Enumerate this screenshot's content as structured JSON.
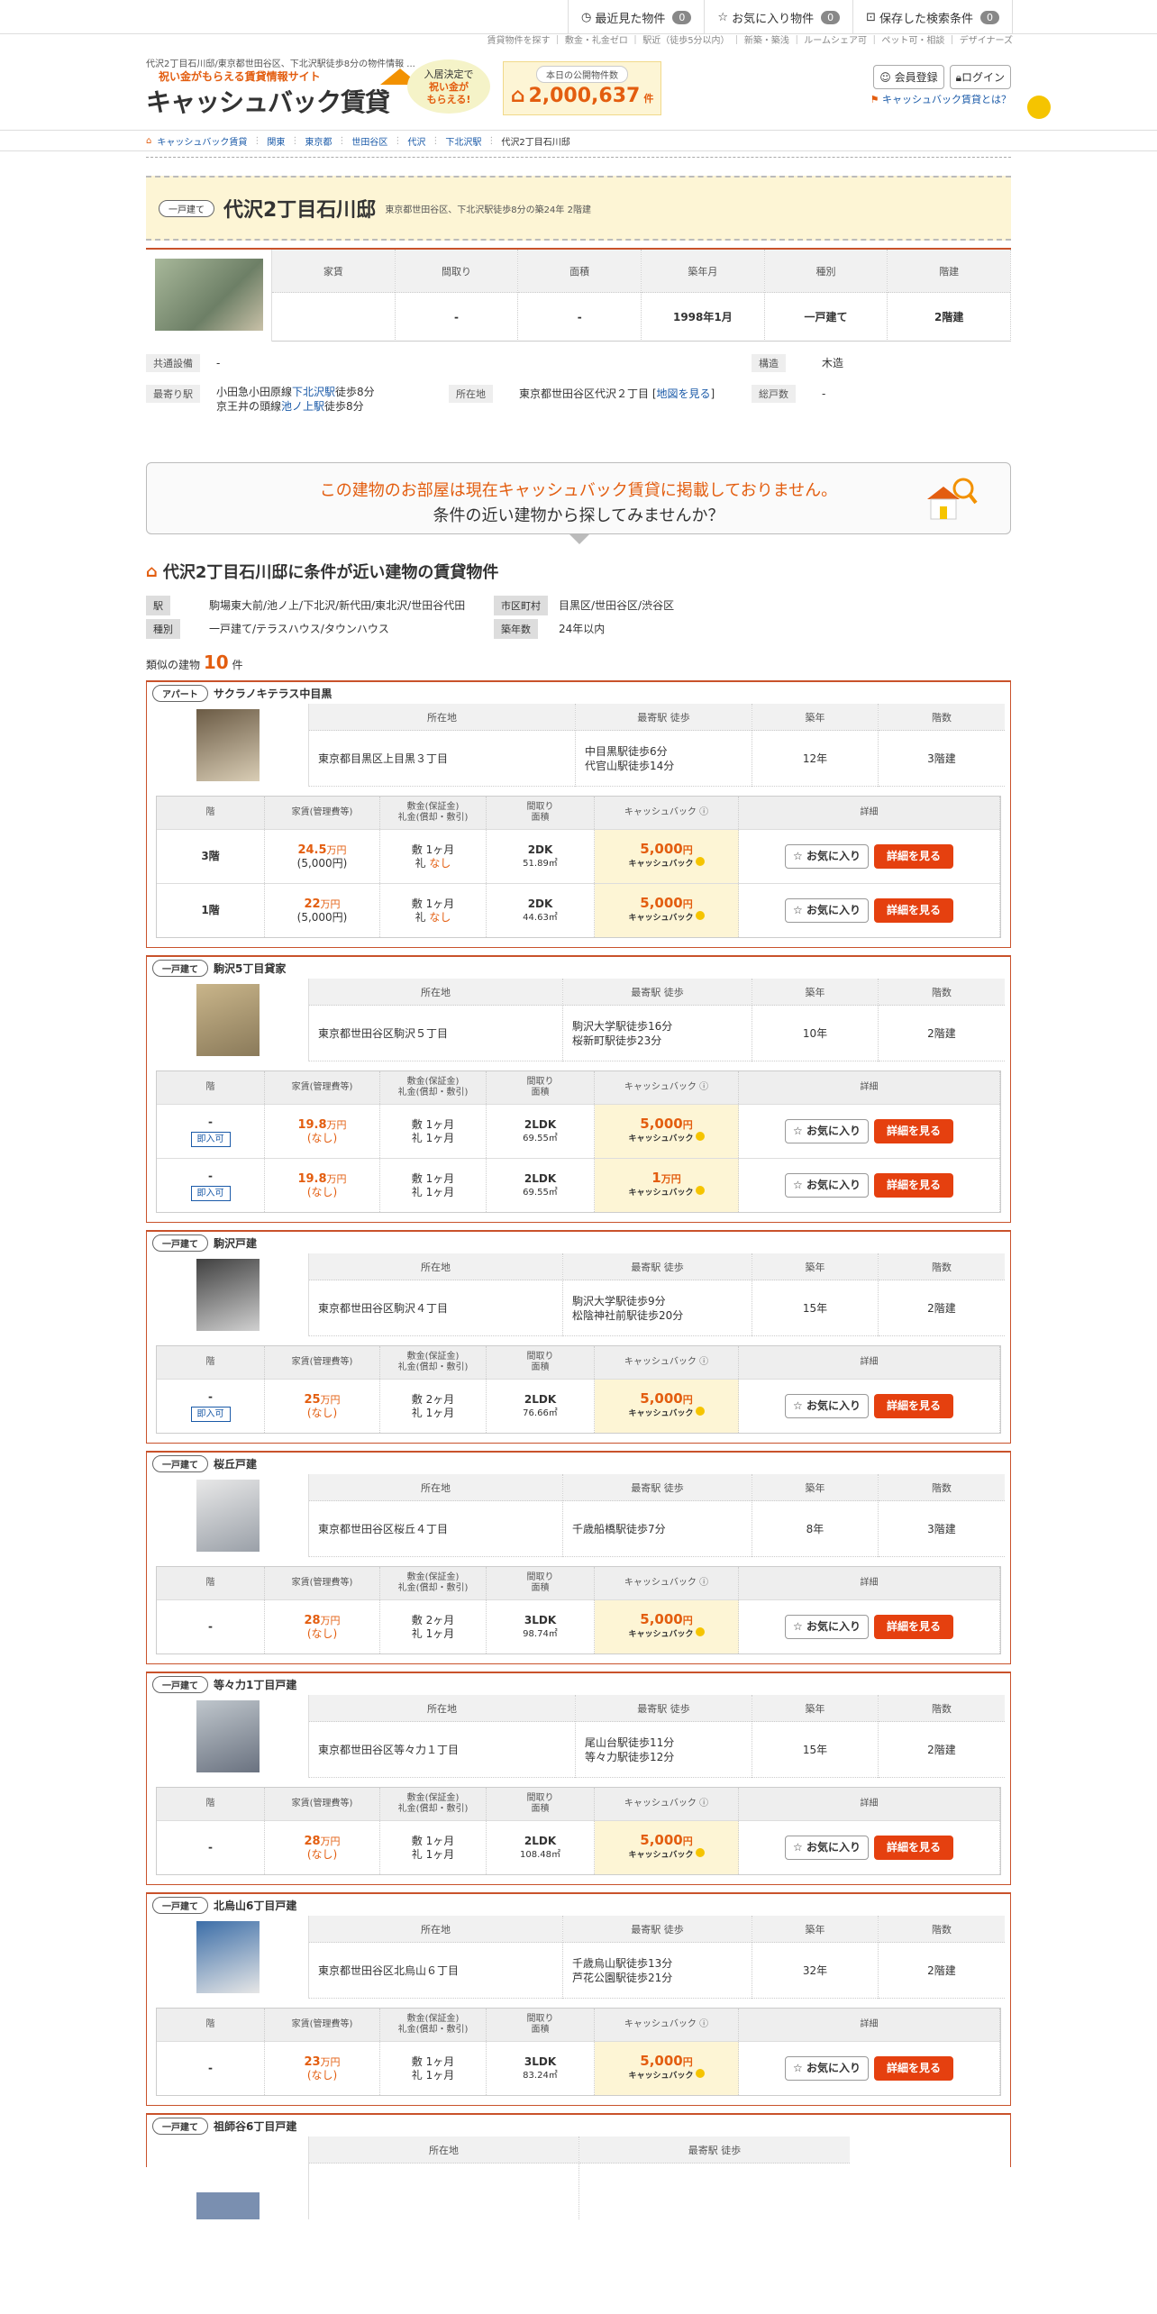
{
  "topnav": {
    "recent": "最近見た物件",
    "recent_count": "0",
    "fav": "お気に入り物件",
    "fav_count": "0",
    "saved": "保存した検索条件",
    "saved_count": "0"
  },
  "subnav": "賃貸物件を探す ｜ 敷金・礼金ゼロ ｜ 駅近（徒歩5分以内） ｜ 新築・築浅 ｜ ルームシェア可 ｜ ペット可・相談 ｜ デザイナーズ",
  "header": {
    "desc": "代沢2丁目石川邸/東京都世田谷区、下北沢駅徒歩8分の物件情報 ...",
    "logo_sub": "祝い金がもらえる賃貸情報サイト",
    "logo_main": "キャッシュバック賃貸",
    "bubble1": "入居決定で",
    "bubble2": "祝い金が",
    "bubble3": "もらえる!",
    "pub_label": "本日の公開物件数",
    "pub_num": "2,000,637",
    "pub_unit": "件",
    "register": "会員登録",
    "login": "ログイン",
    "whatis": "キャッシュバック賃貸とは？"
  },
  "breadcrumb": [
    "キャッシュバック賃貸",
    "関東",
    "東京都",
    "世田谷区",
    "代沢",
    "下北沢駅",
    "代沢2丁目石川邸"
  ],
  "building": {
    "tag": "一戸建て",
    "name": "代沢2丁目石川邸",
    "sub": "東京都世田谷区、下北沢駅徒歩8分の築24年 2階建",
    "cols": [
      {
        "h": "家賃",
        "v": ""
      },
      {
        "h": "間取り",
        "v": "-"
      },
      {
        "h": "面積",
        "v": "-"
      },
      {
        "h": "築年月",
        "v": "1998年1月"
      },
      {
        "h": "種別",
        "v": "一戸建て"
      },
      {
        "h": "階建",
        "v": "2階建"
      }
    ],
    "facility_label": "共通設備",
    "facility": "-",
    "structure_label": "構造",
    "structure": "木造",
    "station_label": "最寄り駅",
    "station1a": "小田急小田原線",
    "station1b": "下北沢駅",
    "station1c": "徒歩8分",
    "station2a": "京王井の頭線",
    "station2b": "池ノ上駅",
    "station2c": "徒歩8分",
    "address_label": "所在地",
    "address": "東京都世田谷区代沢２丁目",
    "map": "地図を見る",
    "units_label": "総戸数",
    "units": "-"
  },
  "notice": {
    "l1": "この建物のお部屋は現在キャッシュバック賃貸に掲載しておりません。",
    "l2": "条件の近い建物から探してみませんか？"
  },
  "section": {
    "title": "代沢2丁目石川邸に条件が近い建物の賃貸物件",
    "st_label": "駅",
    "st": "駒場東大前/池ノ上/下北沢/新代田/東北沢/世田谷代田",
    "city_label": "市区町村",
    "city": "目黒区/世田谷区/渋谷区",
    "type_label": "種別",
    "type": "一戸建て/テラスハウス/タウンハウス",
    "age_label": "築年数",
    "age": "24年以内",
    "similar_pre": "類似の建物",
    "similar_num": "10",
    "similar_unit": "件"
  },
  "headers": {
    "addr": "所在地",
    "station": "最寄駅 徒歩",
    "age": "築年",
    "floors": "階数",
    "floor": "階",
    "rent1": "家賃(管理費等)",
    "dep1": "敷金(保証金)",
    "dep2": "礼金(償却・敷引)",
    "lay1": "間取り",
    "lay2": "面積",
    "cb": "キャッシュバック",
    "detail": "詳細",
    "fav": "お気に入り",
    "view": "詳細を見る",
    "cb_sub": "キャッシュバック",
    "soku": "即入可"
  },
  "cards": [
    {
      "tag": "アパート",
      "name": "サクラノキテラス中目黒",
      "addr": "東京都目黒区上目黒３丁目",
      "st1": "中目黒駅徒歩6分",
      "st2": "代官山駅徒歩14分",
      "age": "12年",
      "floors": "3階建",
      "rows": [
        {
          "floor": "3階",
          "rent": "24.5",
          "mgmt": "(5,000円)",
          "shiki": "敷 1ヶ月",
          "rei_pre": "礼",
          "rei": "なし",
          "lay": "2DK",
          "area": "51.89㎡",
          "cb": "5,000",
          "cbu": "円"
        },
        {
          "floor": "1階",
          "rent": "22",
          "mgmt": "(5,000円)",
          "shiki": "敷 1ヶ月",
          "rei_pre": "礼",
          "rei": "なし",
          "lay": "2DK",
          "area": "44.63㎡",
          "cb": "5,000",
          "cbu": "円"
        }
      ]
    },
    {
      "tag": "一戸建て",
      "name": "駒沢5丁目貸家",
      "addr": "東京都世田谷区駒沢５丁目",
      "st1": "駒沢大学駅徒歩16分",
      "st2": "桜新町駅徒歩23分",
      "age": "10年",
      "floors": "2階建",
      "rows": [
        {
          "floor": "-",
          "rent": "19.8",
          "mgmt": "(なし)",
          "shiki": "敷 1ヶ月",
          "rei_pre": "礼",
          "rei": "1ヶ月",
          "lay": "2LDK",
          "area": "69.55㎡",
          "cb": "5,000",
          "cbu": "円"
        },
        {
          "floor": "-",
          "rent": "19.8",
          "mgmt": "(なし)",
          "shiki": "敷 1ヶ月",
          "rei_pre": "礼",
          "rei": "1ヶ月",
          "lay": "2LDK",
          "area": "69.55㎡",
          "cb": "1",
          "cbu": "万円"
        }
      ]
    },
    {
      "tag": "一戸建て",
      "name": "駒沢戸建",
      "addr": "東京都世田谷区駒沢４丁目",
      "st1": "駒沢大学駅徒歩9分",
      "st2": "松陰神社前駅徒歩20分",
      "age": "15年",
      "floors": "2階建",
      "rows": [
        {
          "floor": "-",
          "rent": "25",
          "mgmt": "(なし)",
          "shiki": "敷 2ヶ月",
          "rei_pre": "礼",
          "rei": "1ヶ月",
          "lay": "2LDK",
          "area": "76.66㎡",
          "cb": "5,000",
          "cbu": "円"
        }
      ]
    },
    {
      "tag": "一戸建て",
      "name": "桜丘戸建",
      "addr": "東京都世田谷区桜丘４丁目",
      "st1": "千歳船橋駅徒歩7分",
      "st2": "",
      "age": "8年",
      "floors": "3階建",
      "rows": [
        {
          "floor": "-",
          "rent": "28",
          "mgmt": "(なし)",
          "shiki": "敷 2ヶ月",
          "rei_pre": "礼",
          "rei": "1ヶ月",
          "lay": "3LDK",
          "area": "98.74㎡",
          "cb": "5,000",
          "cbu": "円"
        }
      ]
    },
    {
      "tag": "一戸建て",
      "name": "等々力1丁目戸建",
      "addr": "東京都世田谷区等々力１丁目",
      "st1": "尾山台駅徒歩11分",
      "st2": "等々力駅徒歩12分",
      "age": "15年",
      "floors": "2階建",
      "rows": [
        {
          "floor": "-",
          "rent": "28",
          "mgmt": "(なし)",
          "shiki": "敷 1ヶ月",
          "rei_pre": "礼",
          "rei": "1ヶ月",
          "lay": "2LDK",
          "area": "108.48㎡",
          "cb": "5,000",
          "cbu": "円"
        }
      ]
    },
    {
      "tag": "一戸建て",
      "name": "北烏山6丁目戸建",
      "addr": "東京都世田谷区北烏山６丁目",
      "st1": "千歳烏山駅徒歩13分",
      "st2": "芦花公園駅徒歩21分",
      "age": "32年",
      "floors": "2階建",
      "rows": [
        {
          "floor": "-",
          "rent": "23",
          "mgmt": "(なし)",
          "shiki": "敷 1ヶ月",
          "rei_pre": "礼",
          "rei": "1ヶ月",
          "lay": "3LDK",
          "area": "83.24㎡",
          "cb": "5,000",
          "cbu": "円"
        }
      ]
    }
  ],
  "last_card": {
    "tag": "一戸建て",
    "name": "祖師谷6丁目戸建"
  },
  "units": {
    "man": "万円"
  }
}
